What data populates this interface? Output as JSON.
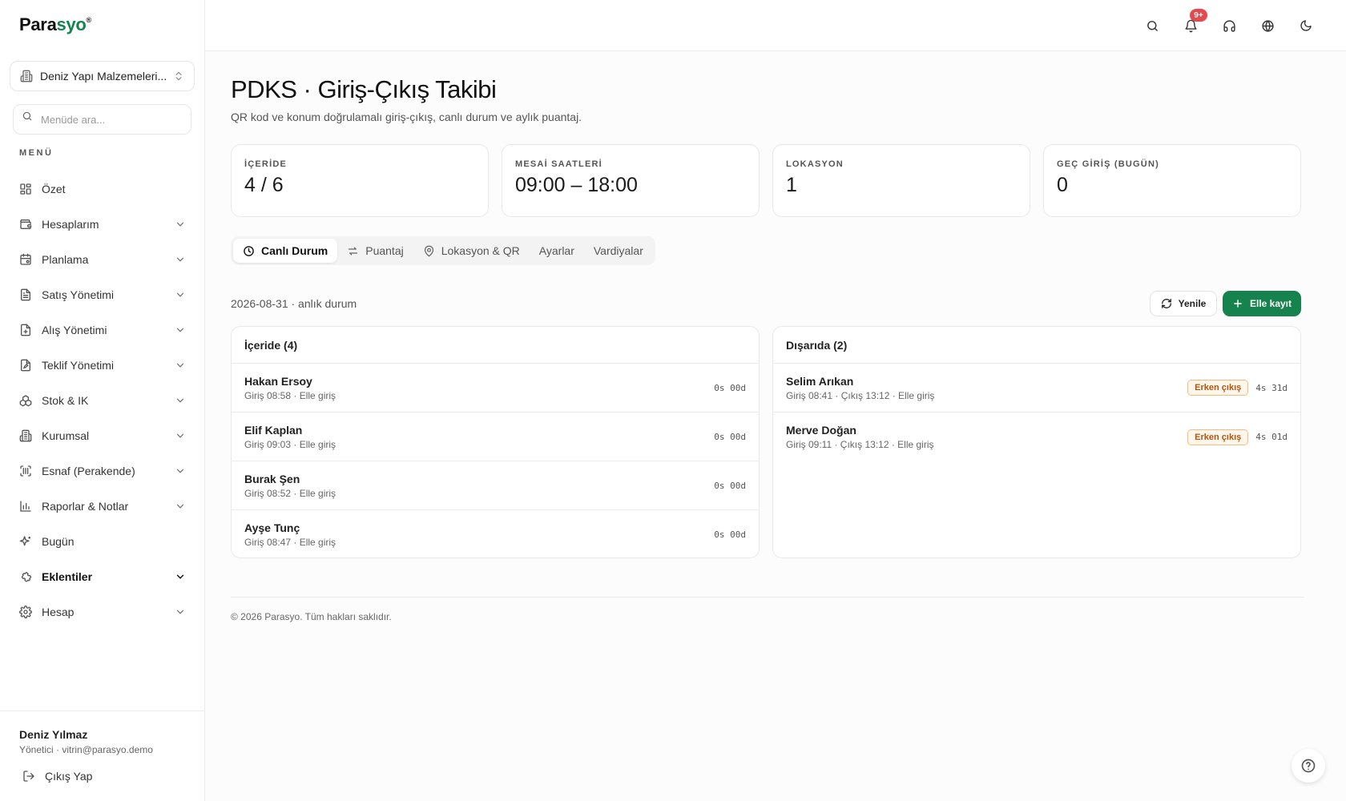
{
  "brand": {
    "name_part1": "Para",
    "name_part2": "syo",
    "registered": "®",
    "accent_color": "#16834f"
  },
  "sidebar": {
    "company": "Deniz Yapı Malzemeleri...",
    "search_placeholder": "Menüde ara...",
    "menu_label": "MENÜ",
    "items": [
      {
        "label": "Özet",
        "icon": "grid-icon"
      },
      {
        "label": "Hesaplarım",
        "icon": "wallet-icon"
      },
      {
        "label": "Planlama",
        "icon": "calendar-icon"
      },
      {
        "label": "Satış Yönetimi",
        "icon": "receipt-icon"
      },
      {
        "label": "Alış Yönetimi",
        "icon": "file-plus-icon"
      },
      {
        "label": "Teklif Yönetimi",
        "icon": "file-edit-icon"
      },
      {
        "label": "Stok & IK",
        "icon": "boxes-icon"
      },
      {
        "label": "Kurumsal",
        "icon": "building-icon"
      },
      {
        "label": "Esnaf (Perakende)",
        "icon": "scan-icon"
      },
      {
        "label": "Raporlar & Notlar",
        "icon": "bar-chart-icon"
      },
      {
        "label": "Bugün",
        "icon": "sparkles-icon"
      },
      {
        "label": "Eklentiler",
        "icon": "puzzle-icon"
      },
      {
        "label": "Hesap",
        "icon": "gear-icon"
      }
    ],
    "user": {
      "name": "Deniz Yılmaz",
      "meta": "Yönetici · vitrin@parasyo.demo",
      "logout": "Çıkış Yap"
    }
  },
  "topbar": {
    "notification_badge": "9+"
  },
  "main": {
    "title": "PDKS · Giriş-Çıkış Takibi",
    "subtitle": "QR kod ve konum doğrulamalı giriş-çıkış, canlı durum ve aylık puantaj.",
    "stats": [
      {
        "label": "İÇERİDE",
        "value": "4 / 6"
      },
      {
        "label": "MESAİ SAATLERİ",
        "value": "09:00 – 18:00"
      },
      {
        "label": "LOKASYON",
        "value": "1"
      },
      {
        "label": "GEÇ GİRİŞ (BUGÜN)",
        "value": "0"
      }
    ],
    "tabs": [
      {
        "label": "Canlı Durum"
      },
      {
        "label": "Puantaj"
      },
      {
        "label": "Lokasyon & QR"
      },
      {
        "label": "Ayarlar"
      },
      {
        "label": "Vardiyalar"
      }
    ],
    "date_line": "2026-08-31 · anlık durum",
    "refresh_label": "Yenile",
    "manual_label": "Elle kayıt",
    "inside": {
      "title": "İçeride (4)",
      "rows": [
        {
          "name": "Hakan Ersoy",
          "detail": "Giriş 08:58 · Elle giriş",
          "duration": "0s 00d"
        },
        {
          "name": "Elif Kaplan",
          "detail": "Giriş 09:03 · Elle giriş",
          "duration": "0s 00d"
        },
        {
          "name": "Burak Şen",
          "detail": "Giriş 08:52 · Elle giriş",
          "duration": "0s 00d"
        },
        {
          "name": "Ayşe Tunç",
          "detail": "Giriş 08:47 · Elle giriş",
          "duration": "0s 00d"
        }
      ]
    },
    "outside": {
      "title": "Dışarıda (2)",
      "rows": [
        {
          "name": "Selim Arıkan",
          "detail": "Giriş 08:41 · Çıkış 13:12 · Elle giriş",
          "tag": "Erken çıkış",
          "duration": "4s 31d"
        },
        {
          "name": "Merve Doğan",
          "detail": "Giriş 09:11 · Çıkış 13:12 · Elle giriş",
          "tag": "Erken çıkış",
          "duration": "4s 01d"
        }
      ]
    },
    "footer": "© 2026 Parasyo. Tüm hakları saklıdır."
  }
}
